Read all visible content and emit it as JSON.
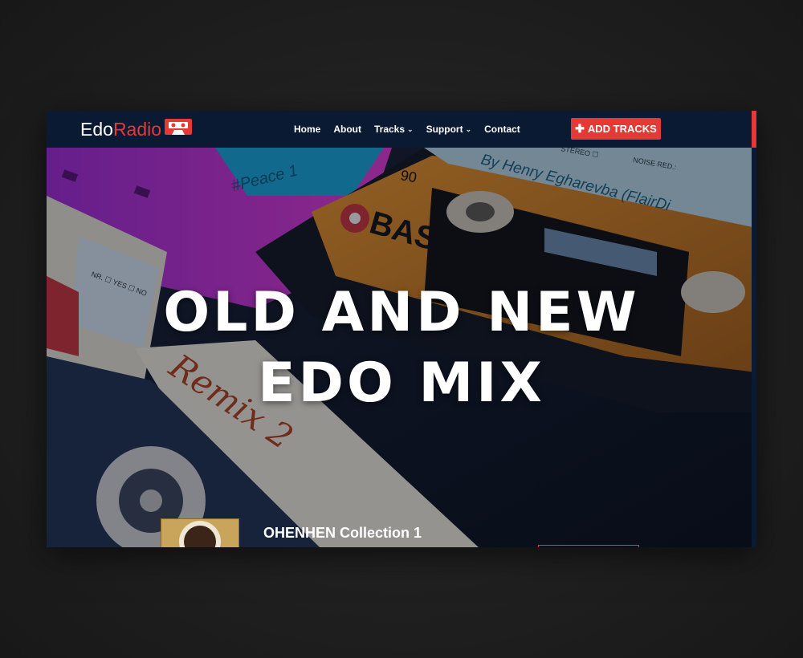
{
  "brand": {
    "part1": "Edo",
    "part2": "Radio",
    "icon": "cassette-icon"
  },
  "nav": {
    "items": [
      {
        "label": "Home",
        "dropdown": false
      },
      {
        "label": "About",
        "dropdown": false
      },
      {
        "label": "Tracks",
        "dropdown": true
      },
      {
        "label": "Support",
        "dropdown": true
      },
      {
        "label": "Contact",
        "dropdown": false
      }
    ],
    "cta_label": "ADD TRACKS",
    "cta_icon": "plus-icon"
  },
  "hero": {
    "title_line1": "OLD AND NEW",
    "title_line2": "EDO MIX",
    "cassette_labels": {
      "pink": "#Peace 1",
      "orange_brand": "BASF",
      "orange_length": "90",
      "orange_writer": "By Henry Egharevba (FlairDi",
      "orange_stereo": "STEREO ☐",
      "orange_noise": "NOISE RED.:",
      "white": "Remix 2",
      "white_side": "NR. ☐ YES ☐ NO"
    }
  },
  "track": {
    "title": "OHENHEN Collection 1"
  },
  "colors": {
    "accent": "#e53935",
    "nav_bg": "#0a1a33",
    "page_bg": "#222222"
  }
}
